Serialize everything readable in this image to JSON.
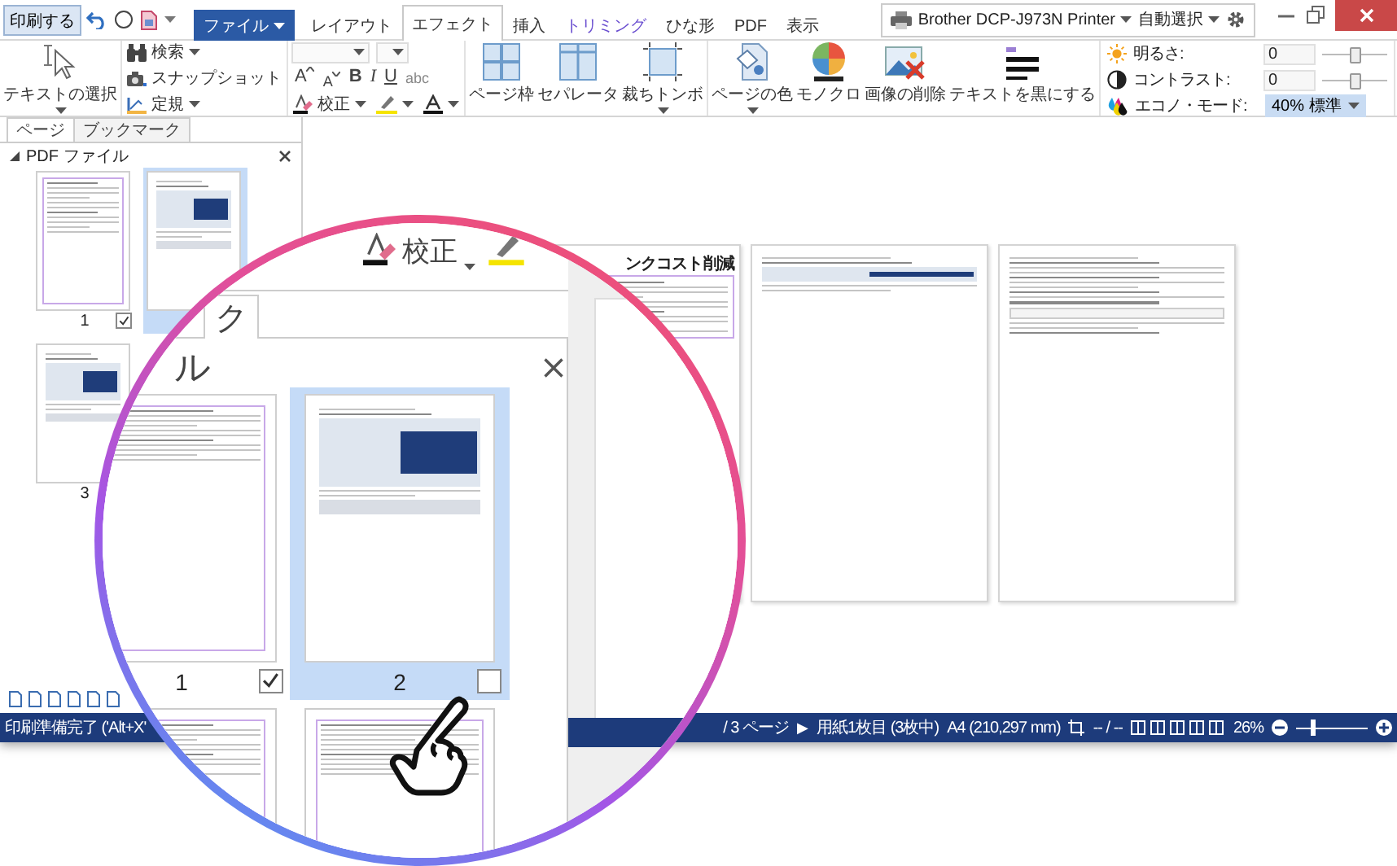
{
  "title_bar": {
    "print_button": "印刷する",
    "tabs": [
      {
        "label": "ファイル",
        "kind": "menu",
        "selected": false
      },
      {
        "label": "レイアウト",
        "kind": "normal",
        "selected": false
      },
      {
        "label": "エフェクト",
        "kind": "normal",
        "selected": true
      },
      {
        "label": "挿入",
        "kind": "normal",
        "selected": false
      },
      {
        "label": "トリミング",
        "kind": "contextual",
        "selected": false
      },
      {
        "label": "ひな形",
        "kind": "normal",
        "selected": false
      },
      {
        "label": "PDF",
        "kind": "normal",
        "selected": false
      },
      {
        "label": "表示",
        "kind": "normal",
        "selected": false
      }
    ],
    "printer": "Brother DCP-J973N Printer",
    "paper_source": "自動選択"
  },
  "ribbon": {
    "select_tool": {
      "label": "テキストの選択",
      "kind": "select",
      "dropdown": true
    },
    "tools": [
      {
        "label": "検索",
        "kind": "find",
        "dropdown": true
      },
      {
        "label": "スナップショット",
        "kind": "snapshot",
        "dropdown": false
      },
      {
        "label": "定規",
        "kind": "ruler",
        "dropdown": true
      }
    ],
    "format_buttons": [
      {
        "label": "A",
        "kind": "grow"
      },
      {
        "label": "A",
        "kind": "shrink"
      },
      {
        "label": "B",
        "kind": "bold"
      },
      {
        "label": "I",
        "kind": "italic"
      },
      {
        "label": "U",
        "kind": "underline"
      },
      {
        "label": "abc",
        "kind": "strike"
      }
    ],
    "proof_button": "校正",
    "page_tools": [
      {
        "label": "ページ枠",
        "kind": "frame",
        "dropdown": false
      },
      {
        "label": "セパレータ",
        "kind": "separator",
        "dropdown": false
      },
      {
        "label": "裁ちトンボ",
        "kind": "crop-marks",
        "dropdown": true
      }
    ],
    "color_tools": [
      {
        "label": "ページの色",
        "kind": "page-color",
        "dropdown": true
      },
      {
        "label": "モノクロ",
        "kind": "mono",
        "dropdown": false
      },
      {
        "label": "画像の削除",
        "kind": "remove-image",
        "dropdown": false
      },
      {
        "label": "テキストを黒にする",
        "kind": "black-text",
        "dropdown": false
      }
    ],
    "brightness": {
      "label": "明るさ:",
      "value": "0",
      "level": 0.5
    },
    "contrast": {
      "label": "コントラスト:",
      "value": "0",
      "level": 0.5
    },
    "eco_mode": {
      "label": "エコノ・モード:",
      "value": "40% 標準"
    }
  },
  "left_panel": {
    "tabs": [
      {
        "label": "ページ",
        "selected": true
      },
      {
        "label": "ブックマーク",
        "selected": false
      }
    ],
    "header": "PDF ファイル",
    "thumbnails": [
      {
        "kind": "text",
        "label": "1",
        "checked": true,
        "selected": false
      },
      {
        "kind": "screenshot",
        "selected": true
      },
      {
        "kind": "screenshot",
        "label": "3",
        "selected": false
      }
    ]
  },
  "preview": {
    "pages": [
      {
        "kind": "text",
        "heading": "ンクコスト削減"
      },
      {
        "kind": "screenshot"
      },
      {
        "kind": "table"
      }
    ]
  },
  "status_bar": {
    "message": "印刷準備完了 ('Alt+X'",
    "page_count": "/ 3 ページ",
    "next_page": "▶",
    "sheet": "用紙1枚目 (3枚中)",
    "paper_size": "A4 (210,297 mm)",
    "selection": "-- / --",
    "zoom": "26%",
    "zoom_slider": {
      "level": 0.25
    }
  },
  "magnifier": {
    "proof_button": "校正",
    "tab": "ク",
    "panel_title": "ル",
    "thumbnails": [
      {
        "kind": "text",
        "label": "1",
        "checked": true,
        "selected": false
      },
      {
        "kind": "screenshot",
        "label": "2",
        "checked": false,
        "selected": true
      }
    ]
  }
}
